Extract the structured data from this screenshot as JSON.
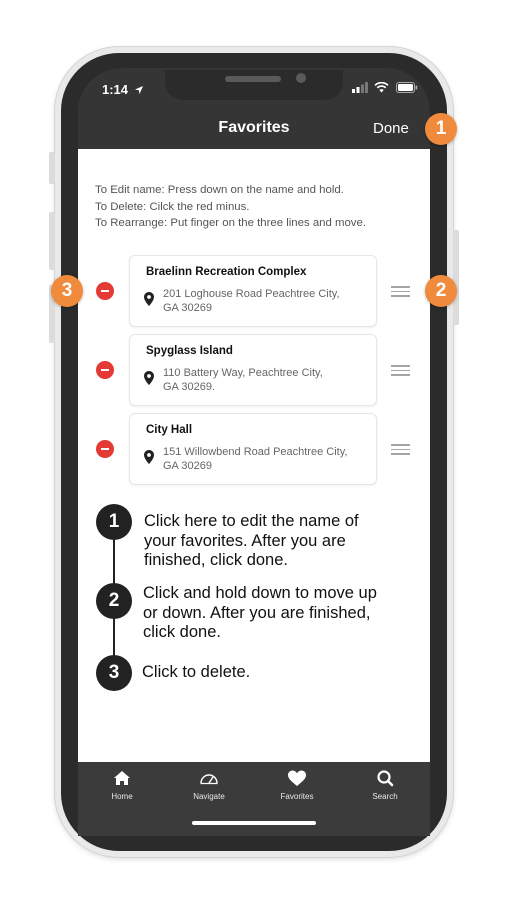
{
  "status_bar": {
    "time": "1:14"
  },
  "header": {
    "title": "Favorites",
    "done_label": "Done"
  },
  "instructions": [
    "To Edit name: Press down on the name and hold.",
    "To Delete: Cilck the red minus.",
    "To Rearrange: Put finger on the three lines and move."
  ],
  "favorites": [
    {
      "name": "Braelinn Recreation Complex",
      "address_line1": "201 Loghouse Road Peachtree City,",
      "address_line2": "GA 30269"
    },
    {
      "name": "Spyglass Island",
      "address_line1": "110 Battery Way, Peachtree City,",
      "address_line2": "GA 30269."
    },
    {
      "name": "City Hall",
      "address_line1": "151 Willowbend Road Peachtree City,",
      "address_line2": "GA 30269"
    }
  ],
  "callouts": [
    "1",
    "2",
    "3"
  ],
  "steps": [
    {
      "number": "1",
      "lines": [
        "Click here to edit the name of",
        "your favorites. After you are",
        "finished, click done."
      ]
    },
    {
      "number": "2",
      "lines": [
        "Click and hold down to move up",
        "or down. After you are finished,",
        "click done."
      ]
    },
    {
      "number": "3",
      "lines": [
        "Click to delete."
      ]
    }
  ],
  "tabbar": {
    "items": [
      {
        "label": "Home",
        "icon": "home-icon"
      },
      {
        "label": "Navigate",
        "icon": "speedometer-icon"
      },
      {
        "label": "Favorites",
        "icon": "heart-icon"
      },
      {
        "label": "Search",
        "icon": "search-icon"
      }
    ]
  },
  "colors": {
    "accent_orange": "#f08a3c",
    "delete_red": "#e53935",
    "bar_dark": "#353535"
  }
}
